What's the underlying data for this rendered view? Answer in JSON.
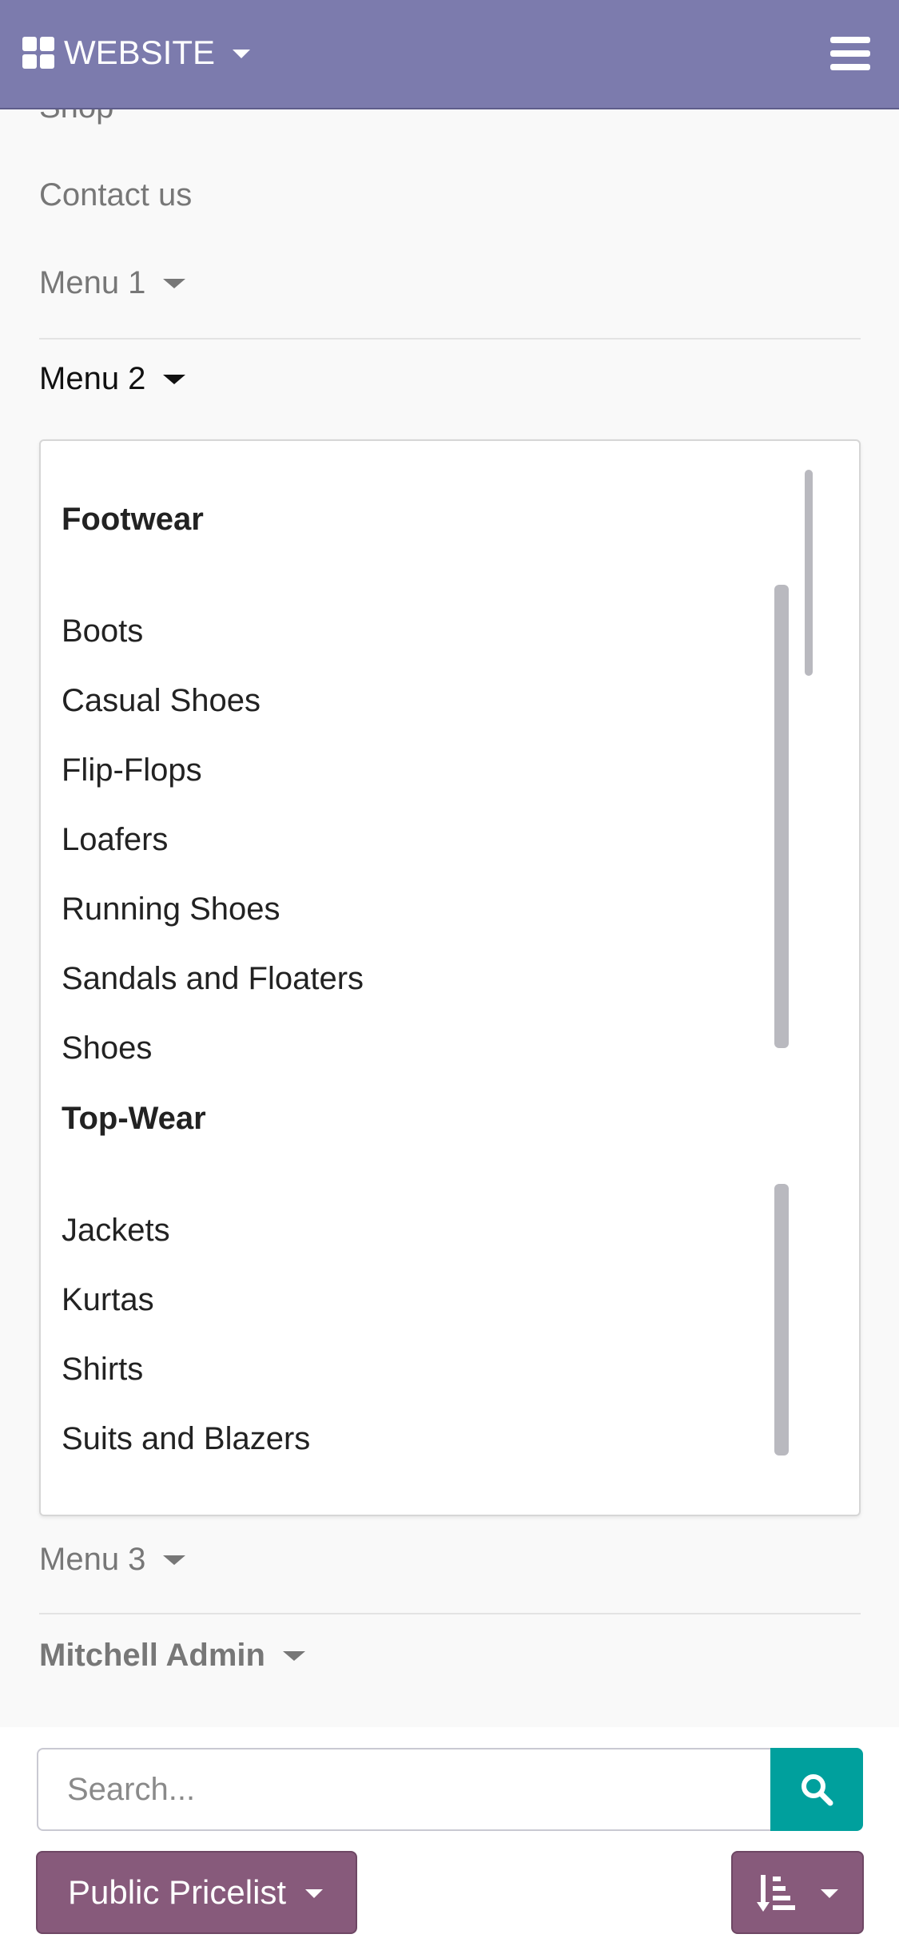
{
  "header": {
    "brand_label": "WEBSITE"
  },
  "menu": {
    "shop_label": "Shop",
    "contact_label": "Contact us",
    "menu1_label": "Menu 1",
    "menu2_label": "Menu 2",
    "menu3_label": "Menu 3",
    "user_label": "Mitchell Admin"
  },
  "dropdown": {
    "groups": [
      {
        "heading": "Footwear",
        "items": [
          "Boots",
          "Casual Shoes",
          "Flip-Flops",
          "Loafers",
          "Running Shoes",
          "Sandals and Floaters",
          "Shoes"
        ]
      },
      {
        "heading": "Top-Wear",
        "items": [
          "Jackets",
          "Kurtas",
          "Shirts",
          "Suits and Blazers"
        ]
      }
    ]
  },
  "search": {
    "placeholder": "Search..."
  },
  "pricelist": {
    "label": "Public Pricelist"
  },
  "icons": {
    "apps": "grid-icon",
    "menu": "hamburger-icon",
    "search": "search-icon",
    "sort": "sort-icon"
  },
  "colors": {
    "header_bg": "#7c7bad",
    "search_button": "#00a09d",
    "primary_button": "#875a7b"
  }
}
